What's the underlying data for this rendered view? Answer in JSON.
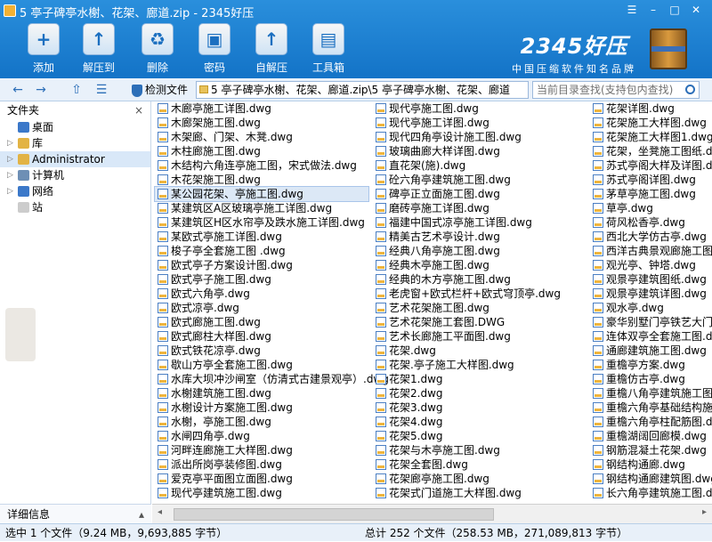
{
  "window": {
    "title": "5 亭子碑亭水榭、花架、廊道.zip - 2345好压",
    "controls": [
      "☰",
      "–",
      "□",
      "✕"
    ]
  },
  "toolbar": {
    "items": [
      {
        "label": "添加",
        "icon": "add-archive-icon",
        "glyph": "+"
      },
      {
        "label": "解压到",
        "icon": "extract-to-icon",
        "glyph": "↑"
      },
      {
        "label": "删除",
        "icon": "recycle-bin-icon",
        "glyph": "♻"
      },
      {
        "label": "密码",
        "icon": "lock-icon",
        "glyph": "▣"
      },
      {
        "label": "自解压",
        "icon": "self-extract-icon",
        "glyph": "↑"
      },
      {
        "label": "工具箱",
        "icon": "toolbox-icon",
        "glyph": "▤"
      }
    ],
    "brand": {
      "name": "2345好压",
      "slogan": "中国压缩软件知名品牌"
    }
  },
  "nav": {
    "back": "←",
    "forward": "→",
    "up": "⇧",
    "view": "☰",
    "detect_label": "检测文件",
    "path": "5 亭子碑亭水榭、花架、廊道.zip\\5 亭子碑亭水榭、花架、廊道",
    "search_placeholder": "当前目录查找(支持包内查找)"
  },
  "sidebar": {
    "header": "文件夹",
    "close": "×",
    "items": [
      {
        "label": "桌面",
        "color": "#3b78c9",
        "arrow": ""
      },
      {
        "label": "库",
        "color": "#e2b344",
        "arrow": "▷"
      },
      {
        "label": "Administrator",
        "color": "#e2b344",
        "arrow": "▷"
      },
      {
        "label": "计算机",
        "color": "#6e8fb5",
        "arrow": "▷"
      },
      {
        "label": "网络",
        "color": "#3b78c9",
        "arrow": "▷"
      },
      {
        "label": "站",
        "color": "#cccccc",
        "arrow": ""
      }
    ],
    "details_label": "详细信息",
    "details_arrow": "▴"
  },
  "files": {
    "columns": [
      [
        "木廊亭施工详图.dwg",
        "木廊架施工图.dwg",
        "木架廊、门架、木凳.dwg",
        "木柱廊施工图.dwg",
        "木结构六角连亭施工图，宋式做法.dwg",
        "木花架施工图.dwg",
        "某公园花架、亭施工图.dwg",
        "某建筑区A区玻璃亭施工详图.dwg",
        "某建筑区H区水帘亭及跌水施工详图.dwg",
        "某欧式亭施工详图.dwg",
        "梭子亭全套施工图 .dwg",
        "欧式亭子方案设计图.dwg",
        "欧式亭子施工图.dwg",
        "欧式六角亭.dwg",
        "欧式凉亭.dwg",
        "欧式廊施工图.dwg",
        "欧式廊柱大样图.dwg",
        "欧式铁花凉亭.dwg",
        "歇山方亭全套施工图.dwg",
        "水库大坝冲沙闸室（仿清式古建景观亭）.dwg",
        "水榭建筑施工图.dwg",
        "水榭设计方案施工图.dwg",
        "水榭，亭施工图.dwg",
        "水闸四角亭.dwg",
        "河畔连廊施工大样图.dwg",
        "派出所岗亭装修图.dwg",
        "爱克亭平面图立面图.dwg",
        "现代亭建筑施工图.dwg"
      ],
      [
        "现代亭施工图.dwg",
        "现代亭施工详图.dwg",
        "现代四角亭设计施工图.dwg",
        "玻璃曲廊大样详图.dwg",
        "直花架(施).dwg",
        "砼六角亭建筑施工图.dwg",
        "碑亭正立面施工图.dwg",
        "磨砖亭施工详图.dwg",
        "福建中国式凉亭施工详图.dwg",
        "精美古艺术亭设计.dwg",
        "经典八角亭施工图.dwg",
        "经典木亭施工图.dwg",
        "经典的木方亭施工图.dwg",
        "老虎窗+欧式栏杆+欧式穹顶亭.dwg",
        "艺术花架施工图.dwg",
        "艺术花架施工套图.DWG",
        "艺术长廊施工平面图.dwg",
        "花架.dwg",
        "花架.亭子施工大样图.dwg",
        "花架1.dwg",
        "花架2.dwg",
        "花架3.dwg",
        "花架4.dwg",
        "花架5.dwg",
        "花架与木亭施工图.dwg",
        "花架全套图.dwg",
        "花架廊亭施工图.dwg",
        "花架式门道施工大样图.dwg"
      ],
      [
        "花架详图.dwg",
        "花架施工大样图.dwg",
        "花架施工大样图1.dwg",
        "花架，坐凳施工图纸.dwg",
        "苏式亭阁大样及详图.dwg",
        "苏式亭阁详图.dwg",
        "茅草亭施工图.dwg",
        "草亭.dwg",
        "荷风松香亭.dwg",
        "西北大学仿古亭.dwg",
        "西洋古典景观廊施工图.dwg",
        "观光亭、钟塔.dwg",
        "观景亭建筑图纸.dwg",
        "观景亭建筑详图.dwg",
        "观水亭.dwg",
        "豪华别墅门亭铁艺大门施工图.dwg",
        "连体双亭全套施工图.dwg",
        "通廊建筑施工图.dwg",
        "重檐亭方案.dwg",
        "重檐仿古亭.dwg",
        "重檐八角亭建筑施工图.dwg",
        "重檐六角亭基础结构施工图.dwg",
        "重檐六角亭柱配筋图.dwg",
        "重檐湖阔回廊模.dwg",
        "钢筋混凝土花架.dwg",
        "钢结构通廊.dwg",
        "钢结构通廊建筑图.dwg",
        "长六角亭建筑施工图.dwg"
      ]
    ],
    "selected": "某公园花架、亭施工图.dwg"
  },
  "scroll": {
    "left": "◂",
    "right": "▸"
  },
  "status": {
    "left": "选中 1 个文件（9.24 MB，9,693,885 字节）",
    "right": "总计 252 个文件（258.53 MB，271,089,813 字节）"
  }
}
